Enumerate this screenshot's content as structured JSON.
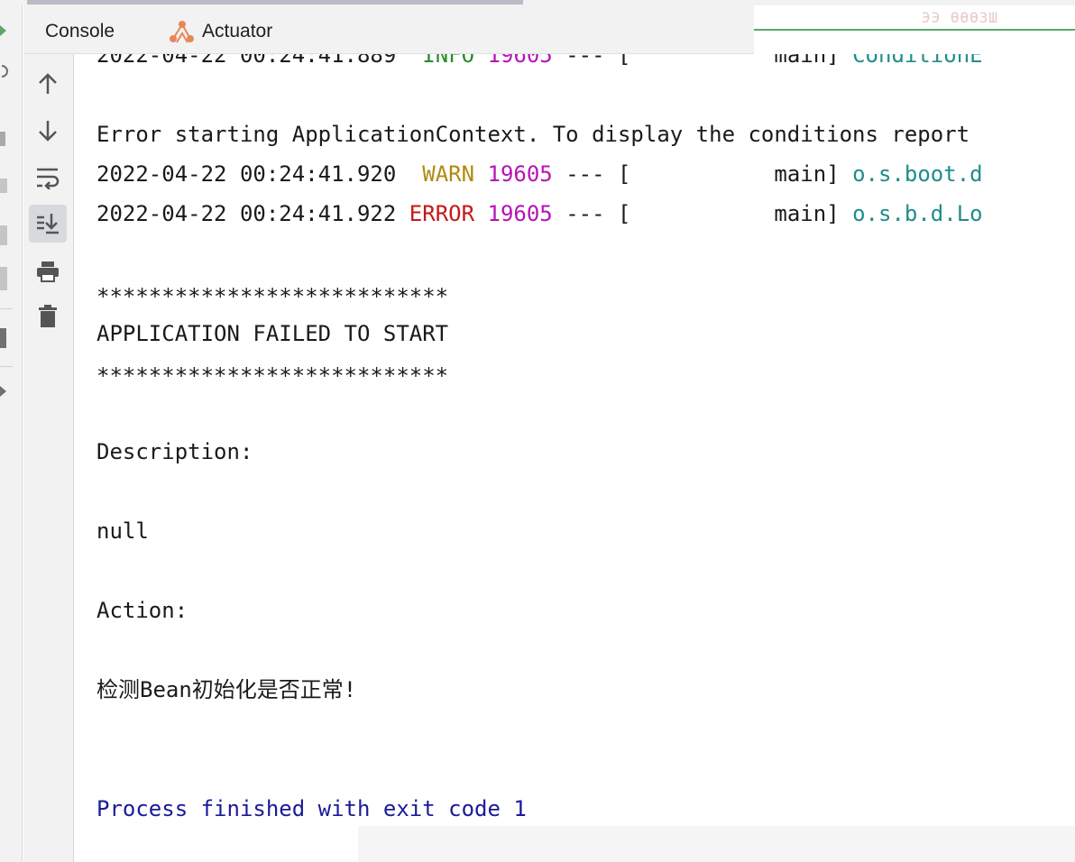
{
  "tabs": {
    "console_label": "Console",
    "actuator_label": "Actuator"
  },
  "faint_header_text": "ЭЭ ӨӨӨЗШ",
  "log": {
    "line0": {
      "timestamp": "2022-04-22 00:24:41.889",
      "level": " INFO",
      "pid": "19605",
      "sep": " --- [",
      "thread": "           main]",
      "logger": "ConditionE"
    },
    "error_starting": "Error starting ApplicationContext. To display the conditions report",
    "line1": {
      "timestamp": "2022-04-22 00:24:41.920",
      "level": "  WARN",
      "pid": "19605",
      "sep": " --- [",
      "thread": "           main]",
      "logger": "o.s.boot.d"
    },
    "line2": {
      "timestamp": "2022-04-22 00:24:41.922",
      "level": " ERROR",
      "pid": "19605",
      "sep": " --- [",
      "thread": "           main]",
      "logger": "o.s.b.d.Lo"
    },
    "stars_top": "***************************",
    "failed_title": "APPLICATION FAILED TO START",
    "stars_bottom": "***************************",
    "description_label": "Description:",
    "description_value": "null",
    "action_label": "Action:",
    "action_value": "检测Bean初始化是否正常!",
    "process_finished": "Process finished with exit code 1"
  },
  "icons": [
    "scroll-up-icon",
    "scroll-down-icon",
    "soft-wrap-icon",
    "scroll-to-end-icon",
    "print-icon",
    "trash-icon",
    "actuator-icon"
  ],
  "colors": {
    "info": "#2a8a2a",
    "warn": "#b08a10",
    "error": "#c41a16",
    "pid": "#b614b6",
    "logger": "#1f8c8c",
    "process": "#1a1a9a",
    "run_green": "#59a869"
  }
}
